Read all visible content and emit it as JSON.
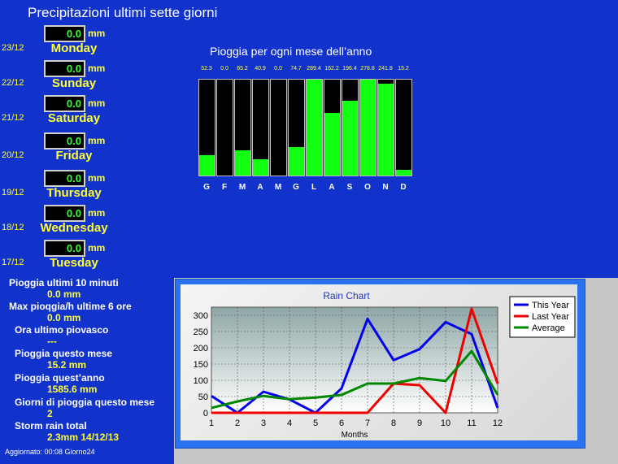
{
  "title": "Precipitazioni  ultimi sette giorni",
  "unit": "mm",
  "days": [
    {
      "date": "23/12",
      "value": "0.0",
      "name": "Monday"
    },
    {
      "date": "22/12",
      "value": "0.0",
      "name": "Sunday"
    },
    {
      "date": "21/12",
      "value": "0.0",
      "name": "Saturday"
    },
    {
      "date": "20/12",
      "value": "0.0",
      "name": "Friday"
    },
    {
      "date": "19/12",
      "value": "0.0",
      "name": "Thursday"
    },
    {
      "date": "18/12",
      "value": "0.0",
      "name": "Wednesday"
    },
    {
      "date": "17/12",
      "value": "0.0",
      "name": "Tuesday"
    }
  ],
  "monthly": {
    "title": "Pioggia per ogni mese dell’anno",
    "labels": [
      "G",
      "F",
      "M",
      "A",
      "M",
      "G",
      "L",
      "A",
      "S",
      "O",
      "N",
      "D"
    ],
    "value_labels": [
      "52.3",
      "0.0",
      "65.2",
      "40.9",
      "0.0",
      "74.7",
      "289.4",
      "162.2",
      "196.4",
      "278.8",
      "241.8",
      "15.2"
    ],
    "fill_fraction": [
      0.21,
      0.0,
      0.26,
      0.17,
      0.0,
      0.3,
      1.0,
      0.65,
      0.78,
      1.0,
      0.96,
      0.06
    ]
  },
  "stats": {
    "rain10_label": "Pioggia ultimi 10 minuti",
    "rain10_value": "0.0 mm",
    "maxrate_label": "Max pioqgia/h ultime 6 ore",
    "maxrate_value": "0.0 mm",
    "lastrain_label": "Ora ultimo piovasco",
    "lastrain_value": "---",
    "month_label": "Pioggia questo mese",
    "month_value": "15.2 mm",
    "year_label": "Pioggia quest’anno",
    "year_value": "1585.6 mm",
    "days_label": "Giorni di pioggia questo mese",
    "days_value": "2",
    "storm_label": "Storm rain total",
    "storm_value": "2.3mm 14/12/13"
  },
  "footer": "Aggiornato: 00:08 Giorno24",
  "colors": {
    "background": "#1133cc",
    "accent": "#ffff33",
    "bar": "#11ff11"
  },
  "chart_data": {
    "type": "line",
    "title": "Rain Chart",
    "xlabel": "Months",
    "ylabel": "",
    "x": [
      1,
      2,
      3,
      4,
      5,
      6,
      7,
      8,
      9,
      10,
      11,
      12
    ],
    "ylim": [
      0,
      325
    ],
    "yticks": [
      0,
      50,
      100,
      150,
      200,
      250,
      300
    ],
    "legend": "top-right",
    "grid": true,
    "series": [
      {
        "name": "This Year",
        "color": "#0000ee",
        "values": [
          52,
          0,
          65,
          41,
          0,
          75,
          289,
          162,
          196,
          279,
          242,
          15
        ]
      },
      {
        "name": "Last Year",
        "color": "#ee0000",
        "values": [
          0,
          0,
          0,
          0,
          0,
          0,
          0,
          90,
          85,
          0,
          320,
          90
        ]
      },
      {
        "name": "Average",
        "color": "#008800",
        "values": [
          15,
          35,
          52,
          42,
          47,
          55,
          90,
          90,
          107,
          98,
          190,
          55
        ]
      }
    ]
  }
}
